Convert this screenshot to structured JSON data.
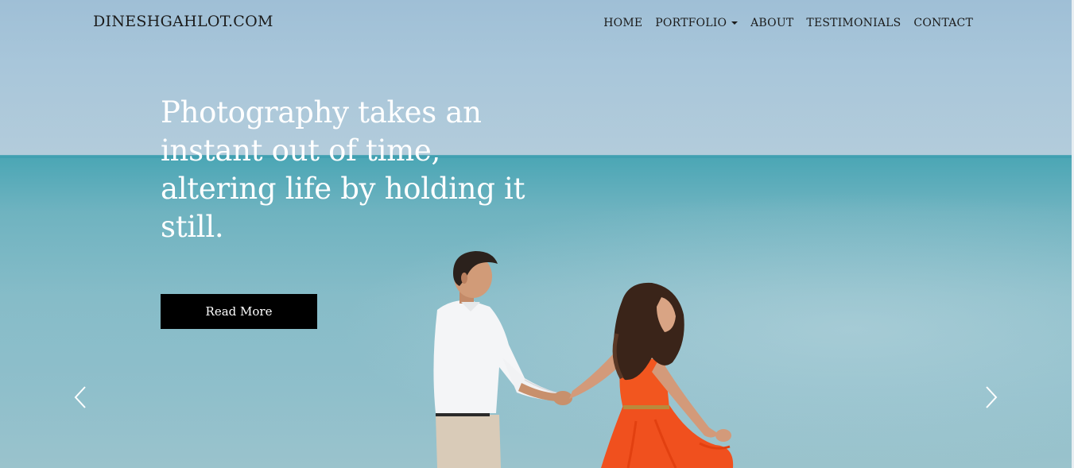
{
  "nav": {
    "brand": "DINESHGAHLOT.COM",
    "items": [
      {
        "label": "HOME",
        "dropdown": false
      },
      {
        "label": "PORTFOLIO",
        "dropdown": true
      },
      {
        "label": "ABOUT",
        "dropdown": false
      },
      {
        "label": "TESTIMONIALS",
        "dropdown": false
      },
      {
        "label": "CONTACT",
        "dropdown": false
      }
    ]
  },
  "hero": {
    "headline": "Photography takes an instant out of time, altering life by holding it still.",
    "button_label": "Read More",
    "prev_icon": "chevron-left-icon",
    "next_icon": "chevron-right-icon"
  },
  "colors": {
    "nav_text": "#1b1b1b",
    "headline_text": "#ffffff",
    "button_bg": "#000000",
    "button_text": "#ffffff",
    "sea": "#6fb3c0",
    "sky": "#a8c6da",
    "dress": "#f0501e"
  }
}
